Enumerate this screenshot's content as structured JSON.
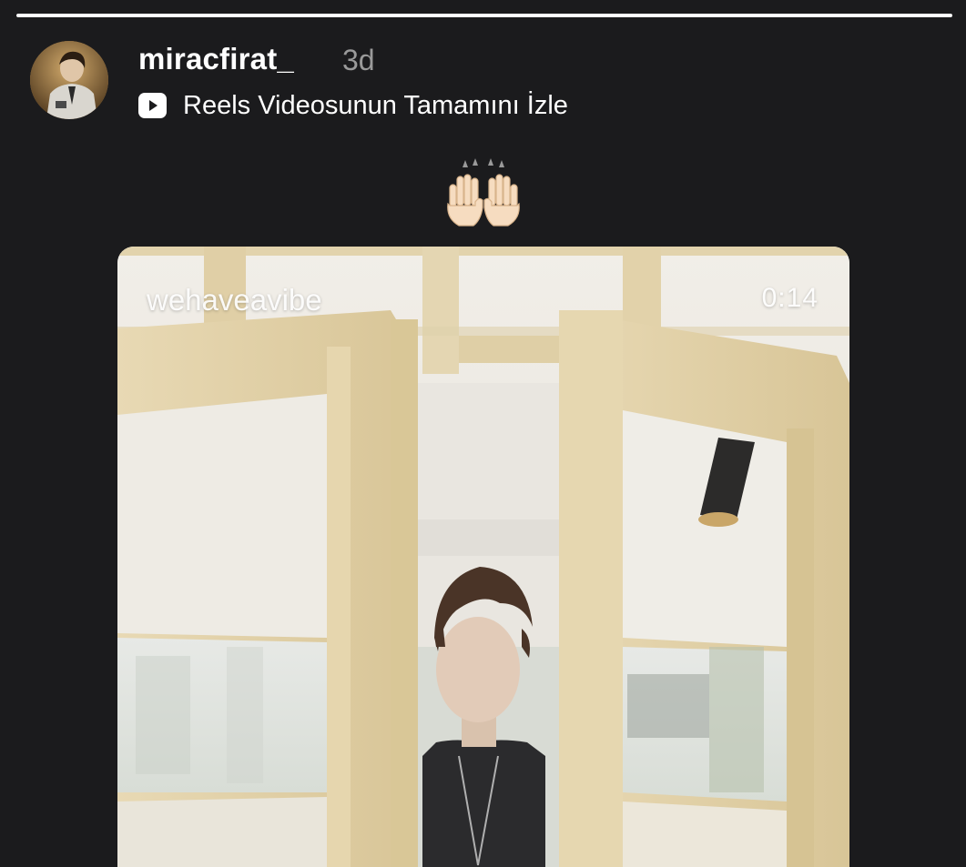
{
  "story": {
    "progress_fraction": 1.0
  },
  "header": {
    "username": "miracfirat_",
    "time_ago": "3d",
    "reels_link_label": "Reels Videosunun Tamamını İzle",
    "reels_icon": "play-square-icon",
    "avatar_icon": "profile-avatar"
  },
  "sticker": {
    "emoji": "raising-hands-icon"
  },
  "reel": {
    "account": "wehaveavibe",
    "duration": "0:14"
  },
  "colors": {
    "background": "#1b1b1d",
    "secondary_text": "#9a9a9a",
    "progress_fill": "#ffffff",
    "window_frame": "#e3d3ab"
  }
}
